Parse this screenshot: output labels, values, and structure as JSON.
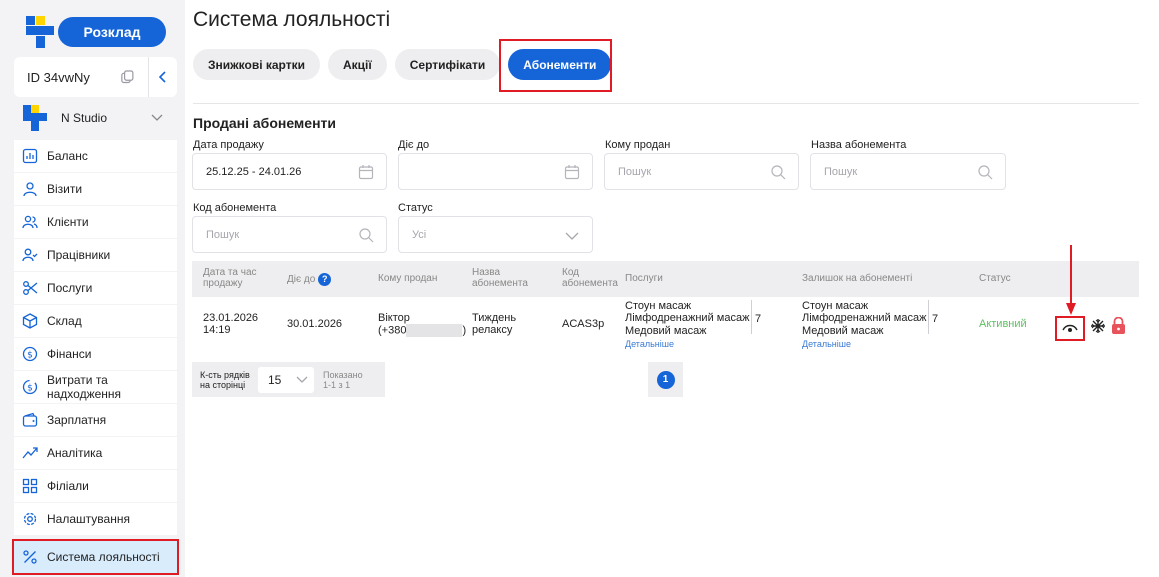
{
  "sidebar": {
    "schedule_button": "Розклад",
    "id_label": "ID 34vwNy",
    "studio_name": "N Studio",
    "items": [
      {
        "label": "Баланс",
        "icon": "chart-bars-icon"
      },
      {
        "label": "Візити",
        "icon": "user-icon"
      },
      {
        "label": "Клієнти",
        "icon": "users-icon"
      },
      {
        "label": "Працівники",
        "icon": "user-check-icon"
      },
      {
        "label": "Послуги",
        "icon": "scissors-icon"
      },
      {
        "label": "Склад",
        "icon": "box-icon"
      },
      {
        "label": "Фінанси",
        "icon": "dollar-circle-icon"
      },
      {
        "label": "Витрати та надходження",
        "icon": "exchange-icon"
      },
      {
        "label": "Зарплатня",
        "icon": "wallet-icon"
      },
      {
        "label": "Аналітика",
        "icon": "trend-icon"
      },
      {
        "label": "Філіали",
        "icon": "grid-icon"
      },
      {
        "label": "Налаштування",
        "icon": "gear-icon"
      },
      {
        "label": "Система лояльності",
        "icon": "percent-icon"
      }
    ]
  },
  "main": {
    "title": "Система лояльності",
    "tabs": [
      {
        "label": "Знижкові картки"
      },
      {
        "label": "Акції"
      },
      {
        "label": "Сертифікати"
      },
      {
        "label": "Абонементи"
      }
    ],
    "section_title": "Продані абонементи",
    "filters": {
      "sale_date_label": "Дата продажу",
      "sale_date_value": "25.12.25 - 24.01.26",
      "valid_until_label": "Діє до",
      "sold_to_label": "Кому продан",
      "sold_to_placeholder": "Пошук",
      "name_label": "Назва абонемента",
      "name_placeholder": "Пошук",
      "code_label": "Код абонемента",
      "code_placeholder": "Пошук",
      "status_label": "Статус",
      "status_value": "Усі"
    },
    "table": {
      "headers": {
        "date_time": "Дата та час продажу",
        "valid_until": "Діє до",
        "sold_to": "Кому продан",
        "name": "Назва абонемента",
        "code": "Код абонемента",
        "services": "Послуги",
        "remaining": "Залишок на абонементі",
        "status": "Статус"
      },
      "row": {
        "date": "23.01.2026",
        "time": "14:19",
        "valid_until": "30.01.2026",
        "client_name": "Віктор",
        "client_phone_prefix": "(+380",
        "client_phone_suffix": ")",
        "name_line1": "Тиждень",
        "name_line2": "релаксу",
        "code": "ACAS3p",
        "services": [
          "Стоун масаж",
          "Лімфодренажний масаж",
          "Медовий масаж"
        ],
        "services_count": "7",
        "services_details": "Детальніше",
        "remaining": [
          "Стоун масаж",
          "Лімфодренажний масаж",
          "Медовий масаж"
        ],
        "remaining_count": "7",
        "remaining_details": "Детальніше",
        "status": "Активний"
      }
    },
    "footer": {
      "rows_label": "К-сть рядків на сторінці",
      "rows_value": "15",
      "shown_text": "Показано 1-1 з 1",
      "page": "1"
    }
  },
  "colors": {
    "accent": "#1565d8",
    "highlight": "#e01b24",
    "status_active": "#5cbf5f"
  }
}
